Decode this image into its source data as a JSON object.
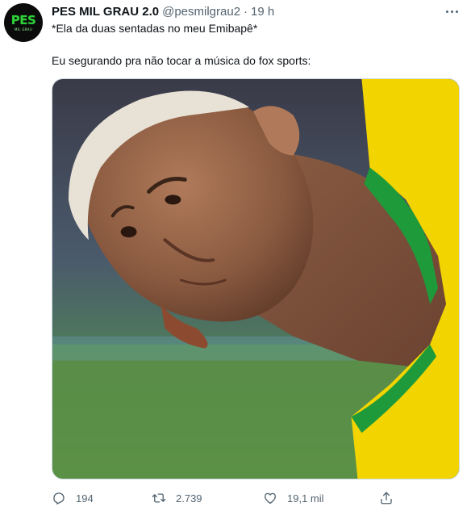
{
  "author": {
    "display_name": "PES MIL GRAU 2.0",
    "handle": "@pesmilgrau2",
    "separator": "·",
    "time": "19 h",
    "avatar": {
      "logo_text": "PES",
      "logo_subtext": "MIL GRAU",
      "color": "#2fd03a"
    }
  },
  "tweet": {
    "line1": "*Ela da duas sentadas no meu Emibapê*",
    "line2": "Eu segurando pra não tocar a música do fox sports:"
  },
  "actions": {
    "reply": {
      "icon": "reply-icon",
      "count": "194"
    },
    "retweet": {
      "icon": "retweet-icon",
      "count": "2.739"
    },
    "like": {
      "icon": "like-icon",
      "count": "19,1 mil"
    },
    "share": {
      "icon": "share-icon"
    }
  },
  "colors": {
    "text_primary": "#0f1419",
    "text_secondary": "#536471",
    "jersey_yellow": "#f2d400",
    "jersey_green": "#1f9a3a"
  }
}
